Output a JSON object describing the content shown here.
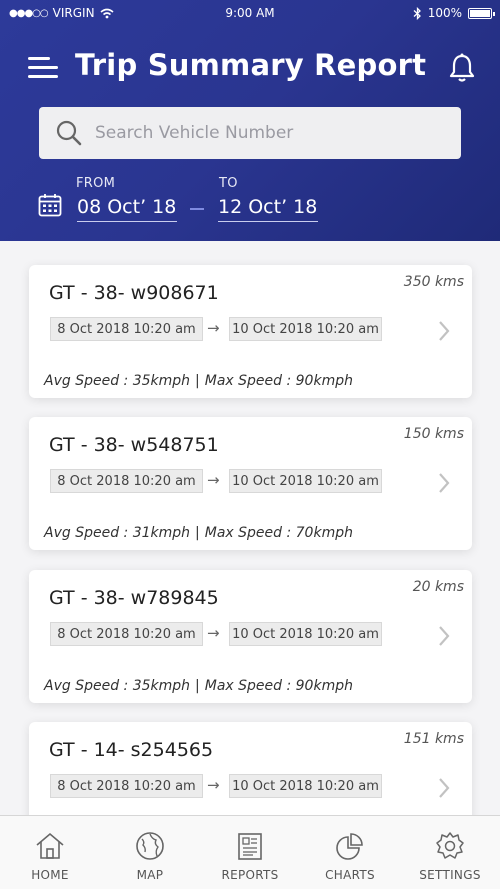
{
  "status_bar": {
    "carrier": "VIRGIN",
    "time": "9:00 AM",
    "battery": "100%"
  },
  "header": {
    "title": "Trip Summary Report",
    "search_placeholder": "Search Vehicle Number",
    "from_label": "FROM",
    "from_date": "08 Oct’ 18",
    "to_label": "TO",
    "to_date": "12 Oct’ 18"
  },
  "trips": [
    {
      "vehicle": "GT - 38- w908671",
      "distance": "350 kms",
      "start": "8 Oct 2018 10:20 am",
      "end": "10 Oct 2018 10:20 am",
      "avg_speed": "Avg Speed : 35kmph",
      "max_speed": "Max Speed : 90kmph"
    },
    {
      "vehicle": "GT - 38- w548751",
      "distance": "150 kms",
      "start": "8 Oct 2018 10:20 am",
      "end": "10 Oct 2018 10:20 am",
      "avg_speed": "Avg Speed : 31kmph",
      "max_speed": "Max Speed : 70kmph"
    },
    {
      "vehicle": "GT - 38- w789845",
      "distance": "20 kms",
      "start": "8 Oct 2018 10:20 am",
      "end": "10 Oct 2018 10:20 am",
      "avg_speed": "Avg Speed : 35kmph",
      "max_speed": "Max Speed : 90kmph"
    },
    {
      "vehicle": "GT - 14- s254565",
      "distance": "151 kms",
      "start": "8 Oct 2018 10:20 am",
      "end": "10 Oct 2018 10:20 am",
      "avg_speed": "",
      "max_speed": ""
    }
  ],
  "tabbar": {
    "home": "HOME",
    "map": "MAP",
    "reports": "REPORTS",
    "charts": "CHARTS",
    "settings": "SETTINGS"
  },
  "colors": {
    "header_bg": "#2a3590",
    "accent": "#7f8be0"
  }
}
